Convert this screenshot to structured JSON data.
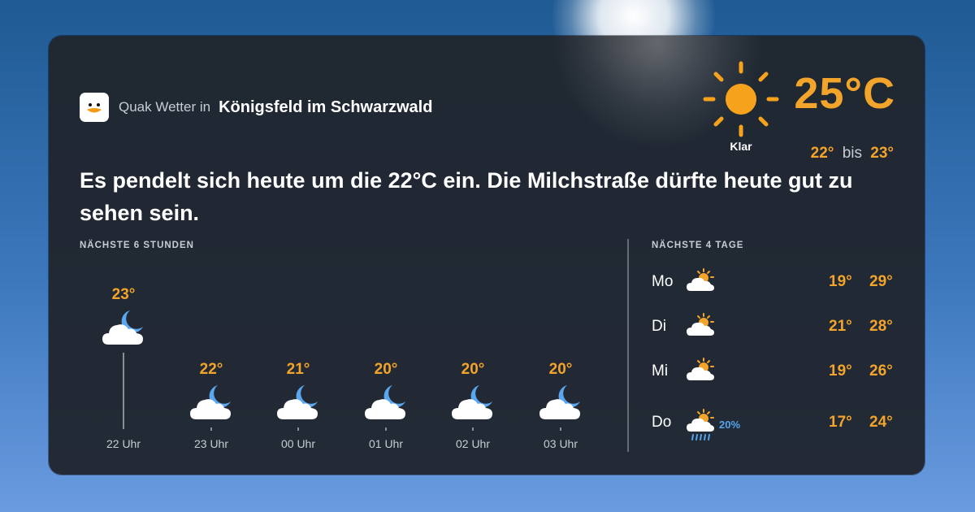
{
  "header": {
    "brand": "Quak Wetter in",
    "location": "Königsfeld im Schwarzwald"
  },
  "current": {
    "temperature": "25°C",
    "condition": "Klar",
    "min": "22°",
    "range_word": "bis",
    "max": "23°",
    "icon": "sun-icon"
  },
  "summary": "Es pendelt sich heute um die 22°C ein. Die Milchstraße dürfte heute gut zu sehen sein.",
  "hourly": {
    "title": "NÄCHSTE 6 STUNDEN",
    "items": [
      {
        "time": "22 Uhr",
        "temp": "23°",
        "temp_value": 23,
        "icon": "cloud-moon-icon"
      },
      {
        "time": "23 Uhr",
        "temp": "22°",
        "temp_value": 22,
        "icon": "cloud-moon-icon"
      },
      {
        "time": "00 Uhr",
        "temp": "21°",
        "temp_value": 21,
        "icon": "cloud-moon-icon"
      },
      {
        "time": "01 Uhr",
        "temp": "20°",
        "temp_value": 20,
        "icon": "cloud-moon-icon"
      },
      {
        "time": "02 Uhr",
        "temp": "20°",
        "temp_value": 20,
        "icon": "cloud-moon-icon"
      },
      {
        "time": "03 Uhr",
        "temp": "20°",
        "temp_value": 20,
        "icon": "cloud-moon-icon"
      }
    ]
  },
  "daily": {
    "title": "NÄCHSTE 4 TAGE",
    "items": [
      {
        "day": "Mo",
        "min": "19°",
        "max": "29°",
        "icon": "sun-cloud-icon",
        "rain": ""
      },
      {
        "day": "Di",
        "min": "21°",
        "max": "28°",
        "icon": "sun-cloud-icon",
        "rain": ""
      },
      {
        "day": "Mi",
        "min": "19°",
        "max": "26°",
        "icon": "sun-cloud-icon",
        "rain": ""
      },
      {
        "day": "Do",
        "min": "17°",
        "max": "24°",
        "icon": "sun-cloud-rain-icon",
        "rain": "20%"
      }
    ]
  },
  "colors": {
    "accent": "#f3a42a",
    "rain": "#55a4ef",
    "moon": "#5aa7f0",
    "card": "#20252e"
  }
}
